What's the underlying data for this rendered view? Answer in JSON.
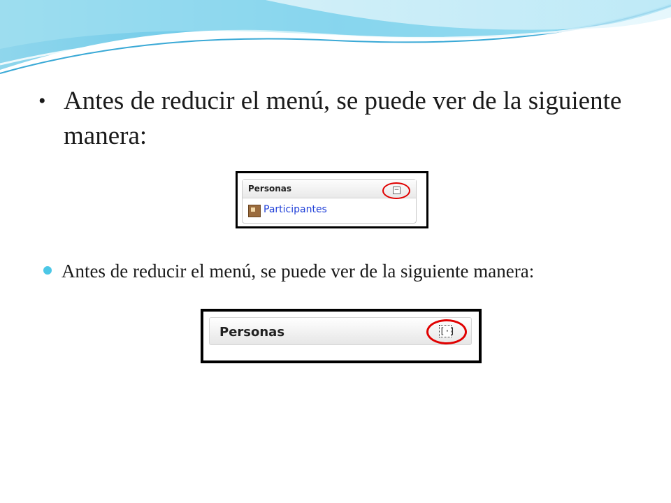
{
  "bullets": [
    {
      "text": "Antes de reducir el menú, se puede ver de la siguiente manera:"
    },
    {
      "text": "Antes de reducir el menú, se puede ver de la siguiente manera:"
    }
  ],
  "screenshot_expanded": {
    "block_title": "Personas",
    "toggle_icon": "collapse-icon",
    "toggle_symbol": "−",
    "link_text": "Participantes",
    "link_icon": "participants-icon"
  },
  "screenshot_collapsed": {
    "block_title": "Personas",
    "toggle_icon": "expand-icon",
    "toggle_symbol": "[·]"
  },
  "colors": {
    "accent": "#4cc7e6",
    "highlight": "#e00000",
    "link": "#1f3fd8"
  }
}
